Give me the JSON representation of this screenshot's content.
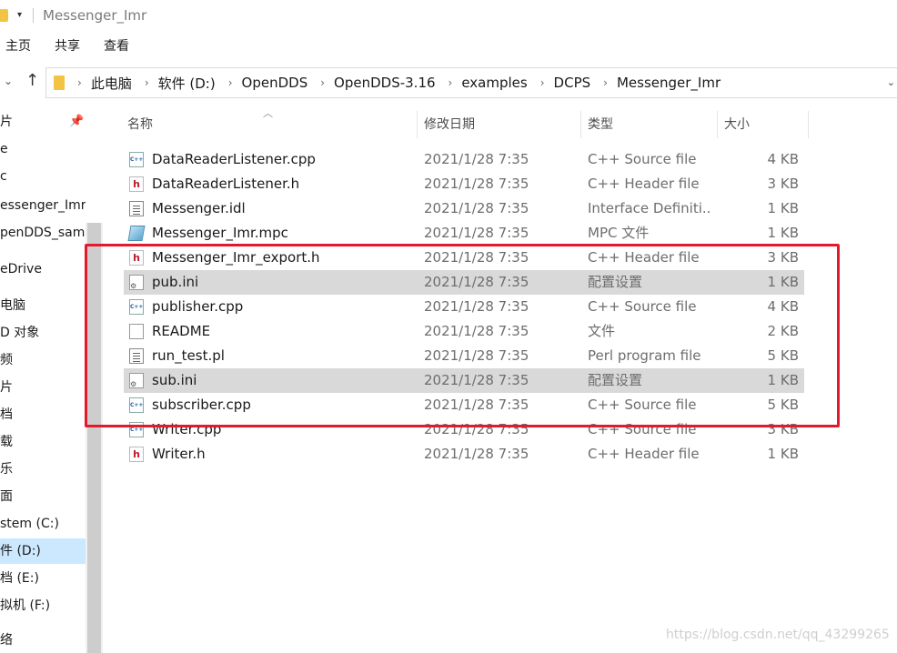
{
  "window": {
    "title": "Messenger_Imr"
  },
  "ribbon": {
    "tabs": [
      "主页",
      "共享",
      "查看"
    ]
  },
  "address": {
    "crumbs": [
      "此电脑",
      "软件 (D:)",
      "OpenDDS",
      "OpenDDS-3.16",
      "examples",
      "DCPS",
      "Messenger_Imr"
    ]
  },
  "nav": {
    "items": [
      {
        "label": "片",
        "selected": false
      },
      {
        "label": "e",
        "selected": false
      },
      {
        "label": "c",
        "selected": false
      },
      {
        "label": "essenger_Imr",
        "selected": false
      },
      {
        "label": "penDDS_samp",
        "selected": false
      },
      {
        "label": "eDrive",
        "selected": false
      },
      {
        "label": "电脑",
        "selected": false
      },
      {
        "label": "D 对象",
        "selected": false
      },
      {
        "label": "频",
        "selected": false
      },
      {
        "label": "片",
        "selected": false
      },
      {
        "label": "档",
        "selected": false
      },
      {
        "label": "载",
        "selected": false
      },
      {
        "label": "乐",
        "selected": false
      },
      {
        "label": "面",
        "selected": false
      },
      {
        "label": "stem (C:)",
        "selected": false
      },
      {
        "label": "件 (D:)",
        "selected": true
      },
      {
        "label": "档 (E:)",
        "selected": false
      },
      {
        "label": "拟机 (F:)",
        "selected": false
      },
      {
        "label": "络",
        "selected": false
      }
    ]
  },
  "columns": {
    "name": "名称",
    "date": "修改日期",
    "type": "类型",
    "size": "大小"
  },
  "files": [
    {
      "name": "DataReaderListener.cpp",
      "date": "2021/1/28 7:35",
      "type": "C++ Source file",
      "size": "4 KB",
      "icon": "cpp-file-icon",
      "highlighted": false
    },
    {
      "name": "DataReaderListener.h",
      "date": "2021/1/28 7:35",
      "type": "C++ Header file",
      "size": "3 KB",
      "icon": "header-file-icon",
      "highlighted": false
    },
    {
      "name": "Messenger.idl",
      "date": "2021/1/28 7:35",
      "type": "Interface Definiti...",
      "size": "1 KB",
      "icon": "text-file-icon",
      "highlighted": false
    },
    {
      "name": "Messenger_Imr.mpc",
      "date": "2021/1/28 7:35",
      "type": "MPC 文件",
      "size": "1 KB",
      "icon": "mpc-file-icon",
      "highlighted": false
    },
    {
      "name": "Messenger_Imr_export.h",
      "date": "2021/1/28 7:35",
      "type": "C++ Header file",
      "size": "3 KB",
      "icon": "header-file-icon",
      "highlighted": false
    },
    {
      "name": "pub.ini",
      "date": "2021/1/28 7:35",
      "type": "配置设置",
      "size": "1 KB",
      "icon": "ini-file-icon",
      "highlighted": true
    },
    {
      "name": "publisher.cpp",
      "date": "2021/1/28 7:35",
      "type": "C++ Source file",
      "size": "4 KB",
      "icon": "cpp-file-icon",
      "highlighted": false
    },
    {
      "name": "README",
      "date": "2021/1/28 7:35",
      "type": "文件",
      "size": "2 KB",
      "icon": "blank-file-icon",
      "highlighted": false
    },
    {
      "name": "run_test.pl",
      "date": "2021/1/28 7:35",
      "type": "Perl program file",
      "size": "5 KB",
      "icon": "text-file-icon",
      "highlighted": false
    },
    {
      "name": "sub.ini",
      "date": "2021/1/28 7:35",
      "type": "配置设置",
      "size": "1 KB",
      "icon": "ini-file-icon",
      "highlighted": true
    },
    {
      "name": "subscriber.cpp",
      "date": "2021/1/28 7:35",
      "type": "C++ Source file",
      "size": "5 KB",
      "icon": "cpp-file-icon",
      "highlighted": false
    },
    {
      "name": "Writer.cpp",
      "date": "2021/1/28 7:35",
      "type": "C++ Source file",
      "size": "3 KB",
      "icon": "cpp-file-icon",
      "highlighted": false
    },
    {
      "name": "Writer.h",
      "date": "2021/1/28 7:35",
      "type": "C++ Header file",
      "size": "1 KB",
      "icon": "header-file-icon",
      "highlighted": false
    }
  ],
  "annotation": {
    "color": "#e6192b"
  },
  "watermark": "https://blog.csdn.net/qq_43299265"
}
